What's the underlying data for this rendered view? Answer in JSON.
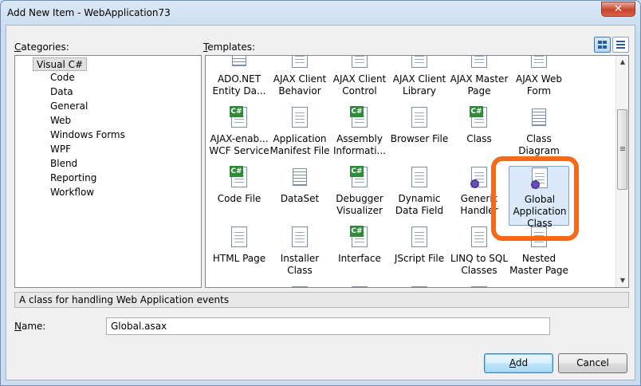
{
  "window": {
    "title": "Add New Item - WebApplication73",
    "close_glyph": "✕"
  },
  "labels": {
    "categories": "Categories:",
    "categories_key": "C",
    "categories_rest": "ategories:",
    "templates_key": "T",
    "templates_rest": "emplates:",
    "name_key": "N",
    "name_rest": "ame:"
  },
  "categories": {
    "root": "Visual C#",
    "items": [
      "Code",
      "Data",
      "General",
      "Web",
      "Windows Forms",
      "WPF",
      "Blend",
      "Reporting",
      "Workflow"
    ]
  },
  "view_buttons": [
    {
      "name": "medium-icons",
      "active": true
    },
    {
      "name": "small-icons-list",
      "active": false
    }
  ],
  "templates": [
    {
      "label": "ADO.NET\nEntity Da...",
      "icon": "grid"
    },
    {
      "label": "AJAX Client\nBehavior",
      "icon": "doc"
    },
    {
      "label": "AJAX Client\nControl",
      "icon": "doc"
    },
    {
      "label": "AJAX Client\nLibrary",
      "icon": "doc"
    },
    {
      "label": "AJAX Master\nPage",
      "icon": "doc"
    },
    {
      "label": "AJAX Web\nForm",
      "icon": "doc"
    },
    {
      "label": "AJAX-enab...\nWCF Service",
      "icon": "csharp"
    },
    {
      "label": "Application\nManifest File",
      "icon": "doc"
    },
    {
      "label": "Assembly\nInformati...",
      "icon": "csharp"
    },
    {
      "label": "Browser File",
      "icon": "doc"
    },
    {
      "label": "Class",
      "icon": "csharp"
    },
    {
      "label": "Class\nDiagram",
      "icon": "grid"
    },
    {
      "label": "Code File",
      "icon": "csharp"
    },
    {
      "label": "DataSet",
      "icon": "grid"
    },
    {
      "label": "Debugger\nVisualizer",
      "icon": "csharp"
    },
    {
      "label": "Dynamic\nData Field",
      "icon": "doc"
    },
    {
      "label": "Generic\nHandler",
      "icon": "gear"
    },
    {
      "label": "Global\nApplication\nClass",
      "icon": "gear"
    },
    {
      "label": "HTML Page",
      "icon": "doc"
    },
    {
      "label": "Installer Class",
      "icon": "doc"
    },
    {
      "label": "Interface",
      "icon": "csharp"
    },
    {
      "label": "JScript File",
      "icon": "doc"
    },
    {
      "label": "LINQ to SQL\nClasses",
      "icon": "doc"
    },
    {
      "label": "Nested\nMaster Page",
      "icon": "doc"
    },
    {
      "label": "",
      "icon": "grid"
    },
    {
      "label": "",
      "icon": "doc"
    },
    {
      "label": "",
      "icon": "doc"
    },
    {
      "label": "",
      "icon": "doc"
    },
    {
      "label": "",
      "icon": "doc"
    },
    {
      "label": "",
      "icon": "cylinder"
    }
  ],
  "selected_template": "Global Application Class",
  "description": "A class for handling Web Application events",
  "name_field": {
    "value": "Global.asax"
  },
  "buttons": {
    "add": "Add",
    "add_key": "A",
    "add_rest": "dd",
    "cancel": "Cancel"
  },
  "accent": {
    "highlight": "#f26a1b",
    "selection": "#dbe9f8"
  }
}
